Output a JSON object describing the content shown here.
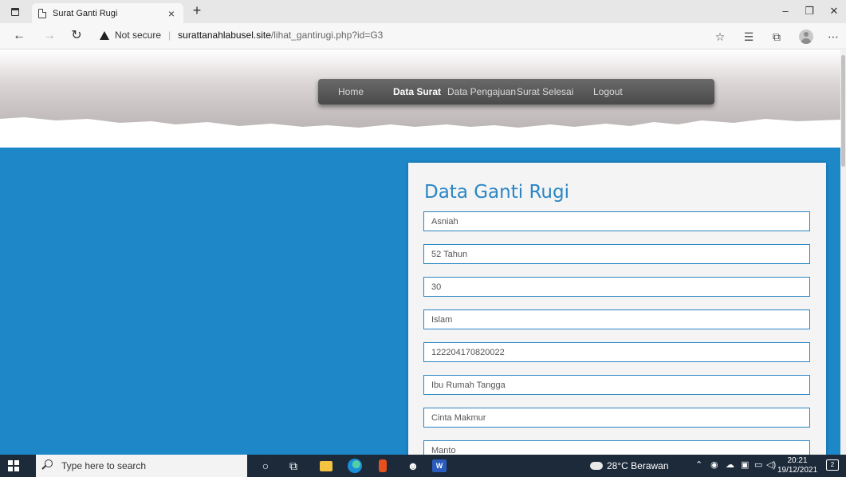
{
  "browser": {
    "tab_title": "Surat Ganti Rugi",
    "tab_close": "×",
    "new_tab": "+",
    "security_label": "Not secure",
    "url_host": "surattanahlabusel.site",
    "url_path": "/lihat_gantirugi.php?id=G3",
    "window_controls": {
      "minimize": "–",
      "restore": "❐",
      "close": "✕"
    },
    "icons": [
      "tab-actions-icon",
      "page-icon",
      "back-icon",
      "forward-icon",
      "refresh-icon",
      "warning-icon",
      "favorites-add-icon",
      "favorites-icon",
      "collections-icon",
      "profile-icon",
      "more-icon"
    ]
  },
  "nav": {
    "items": [
      {
        "label": "Home",
        "active": false
      },
      {
        "label": "Data Surat",
        "active": true
      },
      {
        "label": "Data Pengajuan",
        "active": false
      },
      {
        "label": "Surat Selesai",
        "active": false
      },
      {
        "label": "Logout",
        "active": false
      }
    ]
  },
  "form": {
    "title": "Data Ganti Rugi",
    "fields": [
      "Asniah",
      "52 Tahun",
      "30",
      "Islam",
      "122204170820022",
      "Ibu Rumah Tangga",
      "Cinta Makmur",
      "Manto"
    ]
  },
  "taskbar": {
    "search_placeholder": "Type here to search",
    "weather": "28°C  Berawan",
    "time": "20:21",
    "date": "19/12/2021",
    "notifications": "2"
  },
  "colors": {
    "accent_blue": "#1e87c8",
    "title_blue": "#2a86c4",
    "navbar": "#555555",
    "taskbar": "#1c2a3a"
  }
}
